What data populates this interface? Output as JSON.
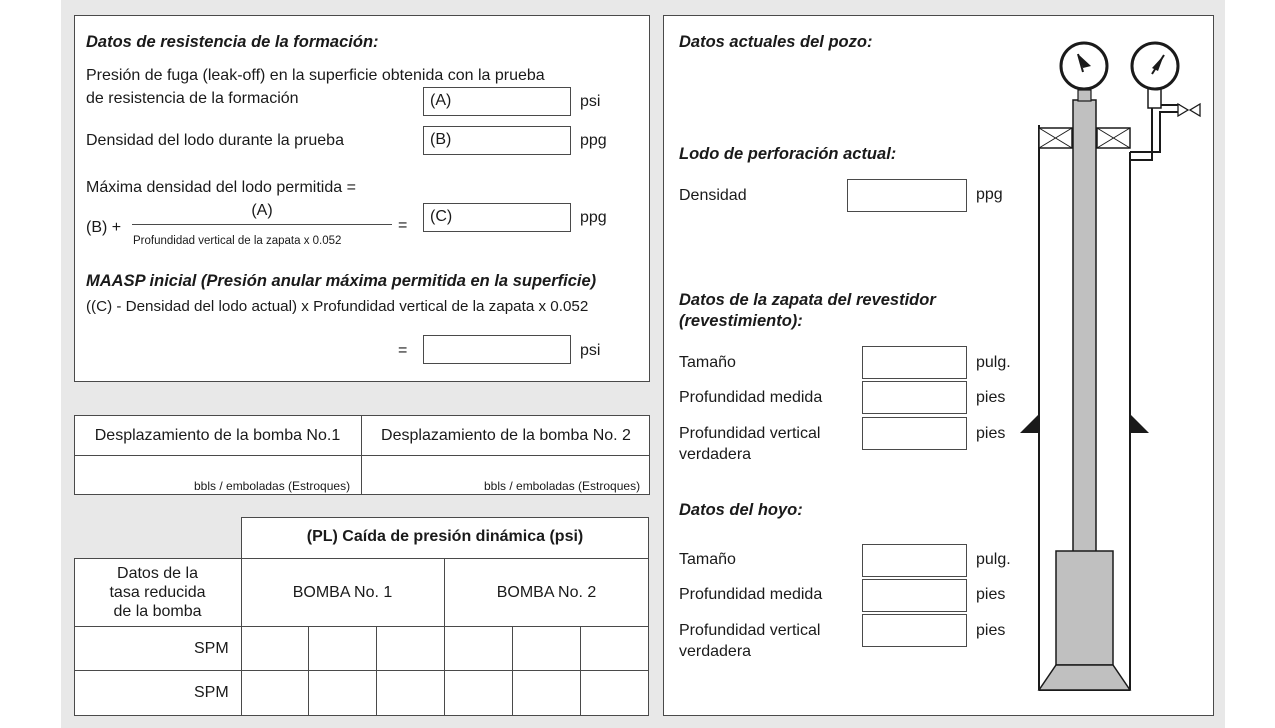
{
  "formation": {
    "title": "Datos de resistencia de la formación:",
    "leakoff_line1": "Presión de fuga (leak-off) en la superficie obtenida con la prueba",
    "leakoff_line2": "de resistencia de la formación",
    "field_a": "(A)",
    "unit_psi": "psi",
    "mud_density_label": "Densidad del lodo durante la prueba",
    "field_b": "(B)",
    "unit_ppg": "ppg",
    "max_density_label": "Máxima densidad del lodo permitida =",
    "formula_b_plus": "(B) +",
    "formula_numerator": "(A)",
    "formula_denominator": "Profundidad vertical de la zapata x 0.052",
    "equals": "=",
    "field_c": "(C)",
    "maasp_title": "MAASP inicial (Presión anular máxima permitida en la superficie)",
    "maasp_formula": "((C) - Densidad del lodo actual) x Profundidad vertical de la zapata x 0.052",
    "maasp_equals": "="
  },
  "pumps": {
    "pump1_header": "Desplazamiento de la bomba No.1",
    "pump2_header": "Desplazamiento de la bomba No. 2",
    "unit": "bbls / emboladas (Estroques)"
  },
  "pressure_table": {
    "title": "(PL) Caída de presión dinámica (psi)",
    "row_header_l1": "Datos de la",
    "row_header_l2": "tasa reducida",
    "row_header_l3": "de la bomba",
    "col_pump1": "BOMBA No. 1",
    "col_pump2": "BOMBA No. 2",
    "rows": [
      "SPM",
      "SPM"
    ]
  },
  "well": {
    "title": "Datos actuales del pozo:",
    "mud_title": "Lodo de perforación actual:",
    "density_label": "Densidad",
    "density_unit": "ppg",
    "shoe_title_l1": "Datos de la zapata del revestidor",
    "shoe_title_l2": "(revestimiento):",
    "size_label": "Tamaño",
    "size_unit": "pulg.",
    "md_label": "Profundidad medida",
    "md_unit": "pies",
    "tvd_label_l1": "Profundidad vertical",
    "tvd_label_l2": "verdadera",
    "tvd_unit": "pies",
    "hole_title": "Datos del hoyo:",
    "hole_size_label": "Tamaño",
    "hole_size_unit": "pulg.",
    "hole_md_label": "Profundidad medida",
    "hole_md_unit": "pies",
    "hole_tvd_label_l1": "Profundidad vertical",
    "hole_tvd_label_l2": "verdadera",
    "hole_tvd_unit": "pies"
  },
  "colors": {
    "pipe": "#c0c0c0",
    "line": "#1a1a1a",
    "sheet": "#e8e8e8"
  }
}
